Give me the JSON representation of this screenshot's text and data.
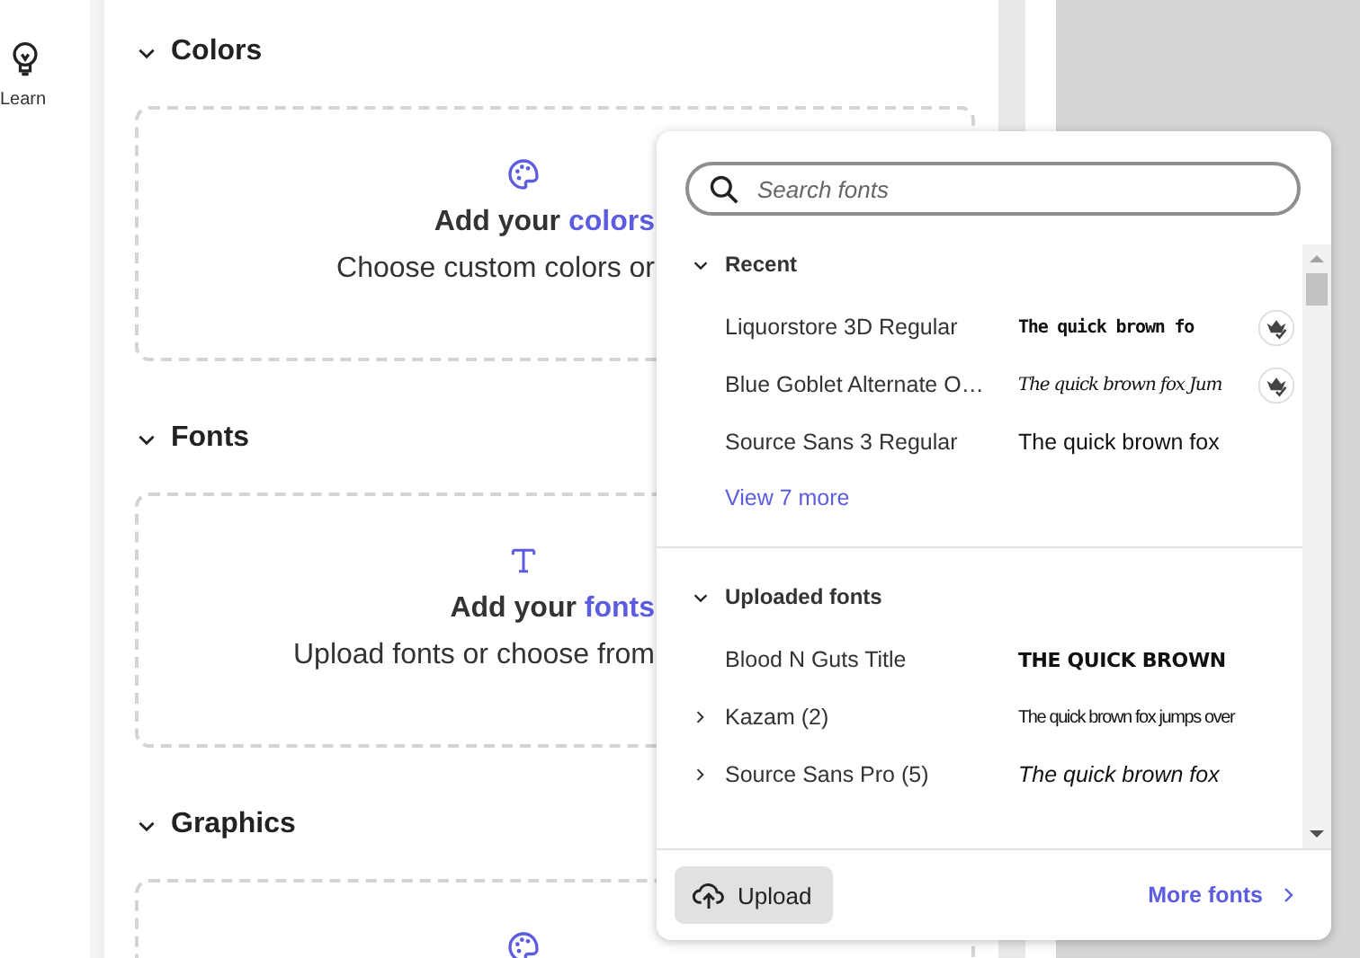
{
  "sidebar": {
    "items": [
      {
        "label": "Learn"
      }
    ]
  },
  "sections": [
    {
      "title": "Colors",
      "expanded": true,
      "card": {
        "heading": "Add your",
        "link": "colors",
        "text": "Choose custom colors or"
      }
    },
    {
      "title": "Fonts",
      "expanded": true,
      "card": {
        "heading": "Add your",
        "link": "fonts",
        "text": "Upload fonts or choose from"
      }
    },
    {
      "title": "Graphics",
      "expanded": true
    }
  ],
  "font_popup": {
    "search": {
      "placeholder": "Search fonts"
    },
    "groups": [
      {
        "title": "Recent",
        "expanded": true,
        "items": [
          {
            "kind": "font",
            "name": "Liquorstore 3D Regular",
            "preview": "The quick brown fo",
            "badge": true
          },
          {
            "kind": "font",
            "name": "Blue Goblet Alternate O…",
            "preview": "The quick brown fox Jum",
            "badge": true
          },
          {
            "kind": "font",
            "name": "Source Sans 3 Regular",
            "preview": "The quick brown fox",
            "badge": false
          }
        ],
        "more": "View 7 more"
      },
      {
        "title": "Uploaded fonts",
        "expanded": true,
        "items": [
          {
            "kind": "font",
            "name": "Blood N Guts Title",
            "preview": "THE QUICK BROWN",
            "badge": false
          },
          {
            "kind": "family",
            "name": "Kazam (2)",
            "expanded": false,
            "preview": "The quick brown fox jumps over",
            "badge": false
          },
          {
            "kind": "family",
            "name": "Source Sans Pro (5)",
            "expanded": false,
            "preview": "The quick brown fox",
            "badge": false
          }
        ]
      }
    ],
    "upload": "Upload",
    "more_fonts": "More fonts"
  }
}
